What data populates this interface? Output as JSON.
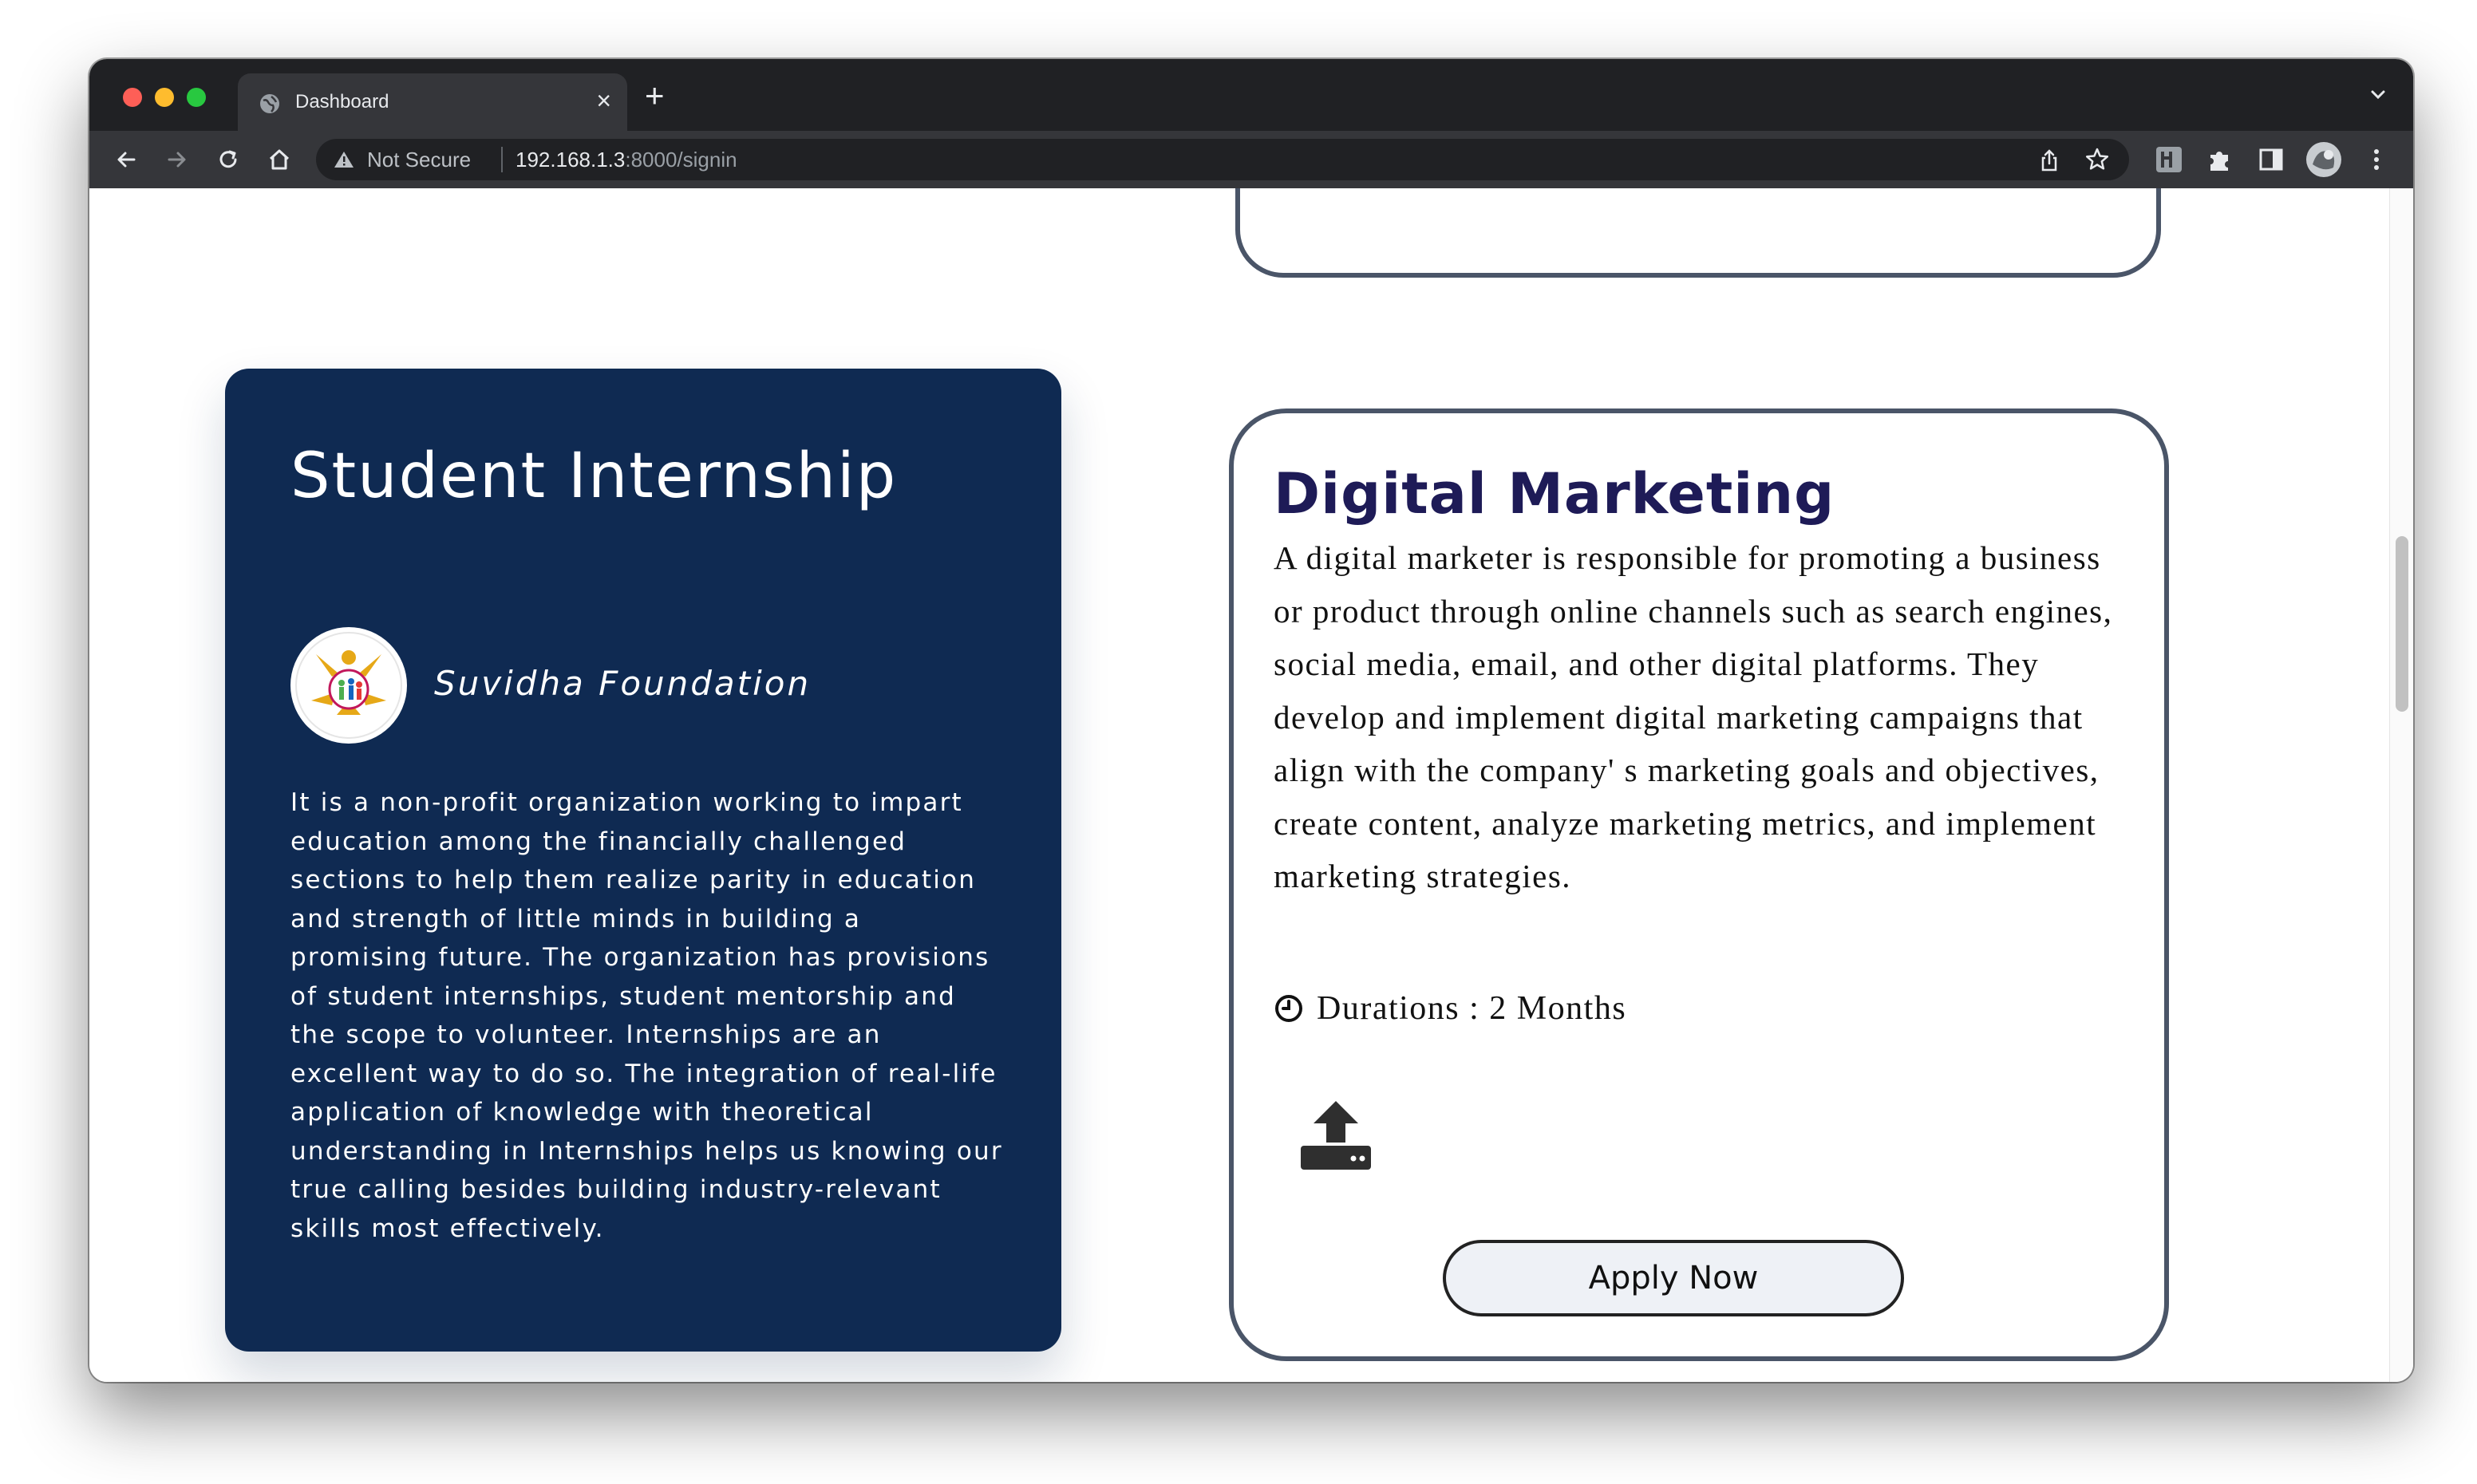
{
  "browser": {
    "tab_title": "Dashboard",
    "close_tab": "×",
    "new_tab": "+",
    "security_label": "Not Secure",
    "url_host": "192.168.1.3",
    "url_path": ":8000/signin"
  },
  "org_card": {
    "heading": "Student Internship",
    "org_name": "Suvidha Foundation",
    "description": "It is a non-profit organization working to impart education among the financially challenged sections to help them realize parity in education and strength of little minds in building a promising future. The organization has provisions of student internships, student mentorship and the scope to volunteer. Internships are an excellent way to do so. The integration of real-life application of knowledge with theoretical understanding in Internships helps us knowing our true calling besides building industry-relevant skills most effectively."
  },
  "job_card": {
    "title": "Digital Marketing",
    "description": "A digital marketer is responsible for promoting a business or product through online channels such as search engines, social media, email, and other digital platforms. They develop and implement digital marketing campaigns that align with the company' s marketing goals and objectives, create content, analyze marketing metrics, and implement marketing strategies.",
    "duration": "Durations : 2 Months",
    "apply_label": "Apply Now"
  },
  "colors": {
    "org_card_bg": "#0f2a52",
    "job_title": "#1e1b57",
    "card_border": "#4a5568",
    "apply_bg": "#eef1f6"
  },
  "icons": [
    "globe-icon",
    "close-icon",
    "plus-icon",
    "chevron-down-icon",
    "back-icon",
    "forward-icon",
    "reload-icon",
    "home-icon",
    "warning-icon",
    "share-icon",
    "star-icon",
    "extension-icon",
    "puzzle-icon",
    "sidepanel-icon",
    "profile-avatar",
    "more-icon",
    "clock-icon",
    "upload-icon"
  ]
}
